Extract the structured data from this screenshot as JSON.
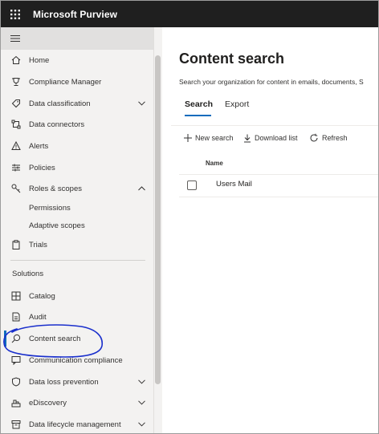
{
  "app": {
    "title": "Microsoft Purview"
  },
  "sidebar": {
    "items": [
      {
        "label": "Home",
        "icon": "home-icon"
      },
      {
        "label": "Compliance Manager",
        "icon": "trophy-icon"
      },
      {
        "label": "Data classification",
        "icon": "tag-icon",
        "expandable": true
      },
      {
        "label": "Data connectors",
        "icon": "connector-icon"
      },
      {
        "label": "Alerts",
        "icon": "warning-icon"
      },
      {
        "label": "Policies",
        "icon": "sliders-icon"
      },
      {
        "label": "Roles & scopes",
        "icon": "key-icon",
        "expanded": true,
        "children": [
          {
            "label": "Permissions"
          },
          {
            "label": "Adaptive scopes"
          }
        ]
      },
      {
        "label": "Trials",
        "icon": "clipboard-icon"
      }
    ],
    "section_label": "Solutions",
    "solutions": [
      {
        "label": "Catalog",
        "icon": "catalog-icon"
      },
      {
        "label": "Audit",
        "icon": "audit-icon"
      },
      {
        "label": "Content search",
        "icon": "search-icon",
        "active": true
      },
      {
        "label": "Communication compliance",
        "icon": "chat-icon"
      },
      {
        "label": "Data loss prevention",
        "icon": "shield-icon",
        "expandable": true
      },
      {
        "label": "eDiscovery",
        "icon": "ediscovery-icon",
        "expandable": true
      },
      {
        "label": "Data lifecycle management",
        "icon": "archive-icon",
        "expandable": true
      }
    ]
  },
  "main": {
    "title": "Content search",
    "description": "Search your organization for content in emails, documents, S",
    "tabs": [
      {
        "label": "Search",
        "active": true
      },
      {
        "label": "Export"
      }
    ],
    "commands": [
      {
        "label": "New search",
        "icon": "plus-icon"
      },
      {
        "label": "Download list",
        "icon": "download-icon"
      },
      {
        "label": "Refresh",
        "icon": "refresh-icon"
      }
    ],
    "table": {
      "columns": [
        "Name"
      ],
      "rows": [
        {
          "name": "Users Mail"
        }
      ]
    }
  },
  "colors": {
    "topbar": "#1f1f1f",
    "accent": "#0f6cbd",
    "sidebar": "#f3f2f1",
    "annotation": "#1a2fcc"
  }
}
